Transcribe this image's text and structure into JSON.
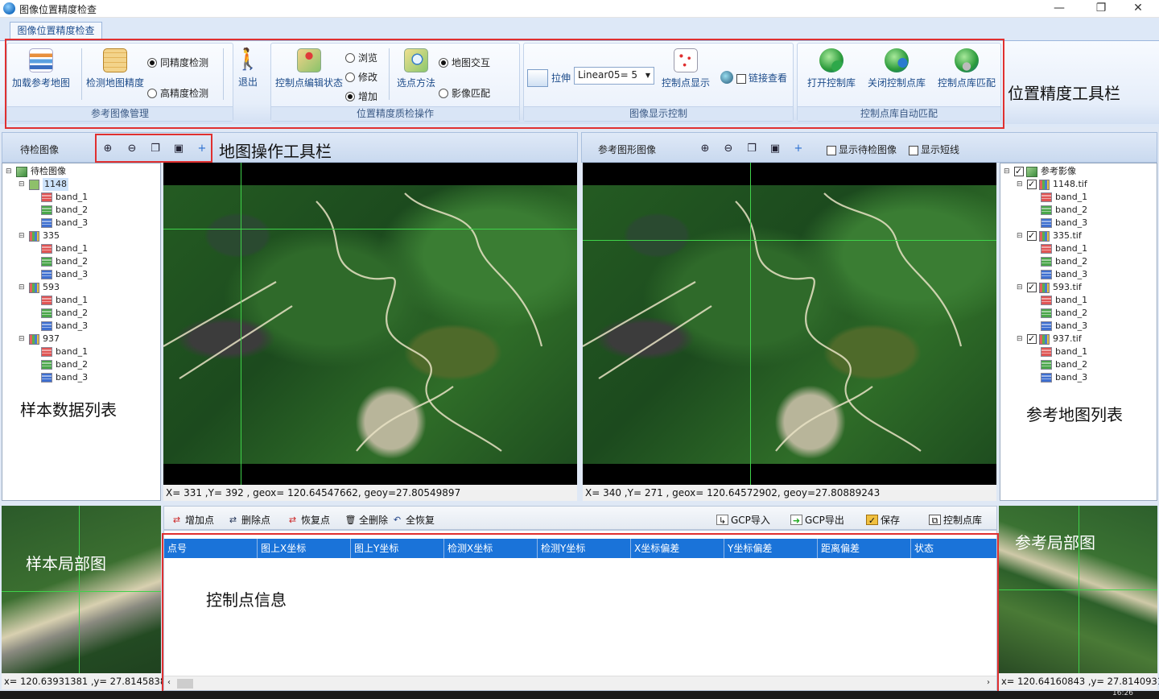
{
  "window": {
    "title": "图像位置精度检查",
    "minimize": "—",
    "restore": "❐",
    "close": "✕"
  },
  "ribbon": {
    "tab": "图像位置精度检查",
    "group_reference": {
      "caption": "参考图像管理",
      "load_ref": "加载参考地图",
      "check_precision": "检测地图精度",
      "radio_same": "同精度检测",
      "radio_high": "高精度检测",
      "exit": "退出",
      "selected": "同精度检测"
    },
    "group_check": {
      "caption": "位置精度质检操作",
      "edit_state": "控制点编辑状态",
      "r_browse": "浏览",
      "r_modify": "修改",
      "r_add": "增加",
      "select_method": "选点方法",
      "r_map_interact": "地图交互",
      "r_image_match": "影像匹配",
      "selected_state": "增加",
      "selected_method": "地图交互"
    },
    "group_display": {
      "caption": "图像显示控制",
      "stretch_label": "拉伸",
      "stretch_value": "Linear05= 5",
      "cp_display": "控制点显示",
      "link_view": "链接查看",
      "link_checked": false
    },
    "group_library": {
      "caption": "控制点库自动匹配",
      "open_lib": "打开控制库",
      "close_lib": "关闭控制点库",
      "match_lib": "控制点库匹配"
    }
  },
  "callouts": {
    "ribbon": "位置精度工具栏",
    "map_toolbar": "地图操作工具栏",
    "sample_list": "样本数据列表",
    "reference_list": "参考地图列表",
    "sample_local": "样本局部图",
    "reference_local": "参考局部图",
    "cp_info": "控制点信息"
  },
  "left_toolbar": {
    "title": "待检图像"
  },
  "right_toolbar": {
    "title": "参考图形图像",
    "show_pending": "显示待检图像",
    "show_short": "显示短线"
  },
  "left_tree": {
    "root": "待检图像",
    "nodes": [
      {
        "name": "1148",
        "bands": [
          "band_1",
          "band_2",
          "band_3"
        ]
      },
      {
        "name": "335",
        "bands": [
          "band_1",
          "band_2",
          "band_3"
        ]
      },
      {
        "name": "593",
        "bands": [
          "band_1",
          "band_2",
          "band_3"
        ]
      },
      {
        "name": "937",
        "bands": [
          "band_1",
          "band_2",
          "band_3"
        ]
      }
    ]
  },
  "right_tree": {
    "root": "参考影像",
    "nodes": [
      {
        "name": "1148.tif",
        "bands": [
          "band_1",
          "band_2",
          "band_3"
        ]
      },
      {
        "name": "335.tif",
        "bands": [
          "band_1",
          "band_2",
          "band_3"
        ]
      },
      {
        "name": "593.tif",
        "bands": [
          "band_1",
          "band_2",
          "band_3"
        ]
      },
      {
        "name": "937.tif",
        "bands": [
          "band_1",
          "band_2",
          "band_3"
        ]
      }
    ]
  },
  "left_map": {
    "status": "X= 331 ,Y= 392 , geox= 120.64547662, geoy=27.80549897"
  },
  "right_map": {
    "status": "X= 340 ,Y= 271 , geox= 120.64572902, geoy=27.80889243"
  },
  "sample_local": {
    "status": "x= 120.63931381 ,y= 27.8145838"
  },
  "reference_local": {
    "status": "x= 120.64160843 ,y= 27.8140931"
  },
  "gcp_toolbar": {
    "add": "增加点",
    "delete": "删除点",
    "restore": "恢复点",
    "delete_all": "全删除",
    "restore_all": "全恢复",
    "gcp_import": "GCP导入",
    "gcp_export": "GCP导出",
    "save": "保存",
    "cp_library": "控制点库"
  },
  "gcp_table": {
    "columns": [
      "点号",
      "图上X坐标",
      "图上Y坐标",
      "检测X坐标",
      "检测Y坐标",
      "X坐标偏差",
      "Y坐标偏差",
      "距离偏差",
      "状态"
    ],
    "rows": []
  },
  "taskbar": {
    "clock": "16:26"
  },
  "colors": {
    "accent": "#1a73d9",
    "highlight": "#e03030"
  }
}
